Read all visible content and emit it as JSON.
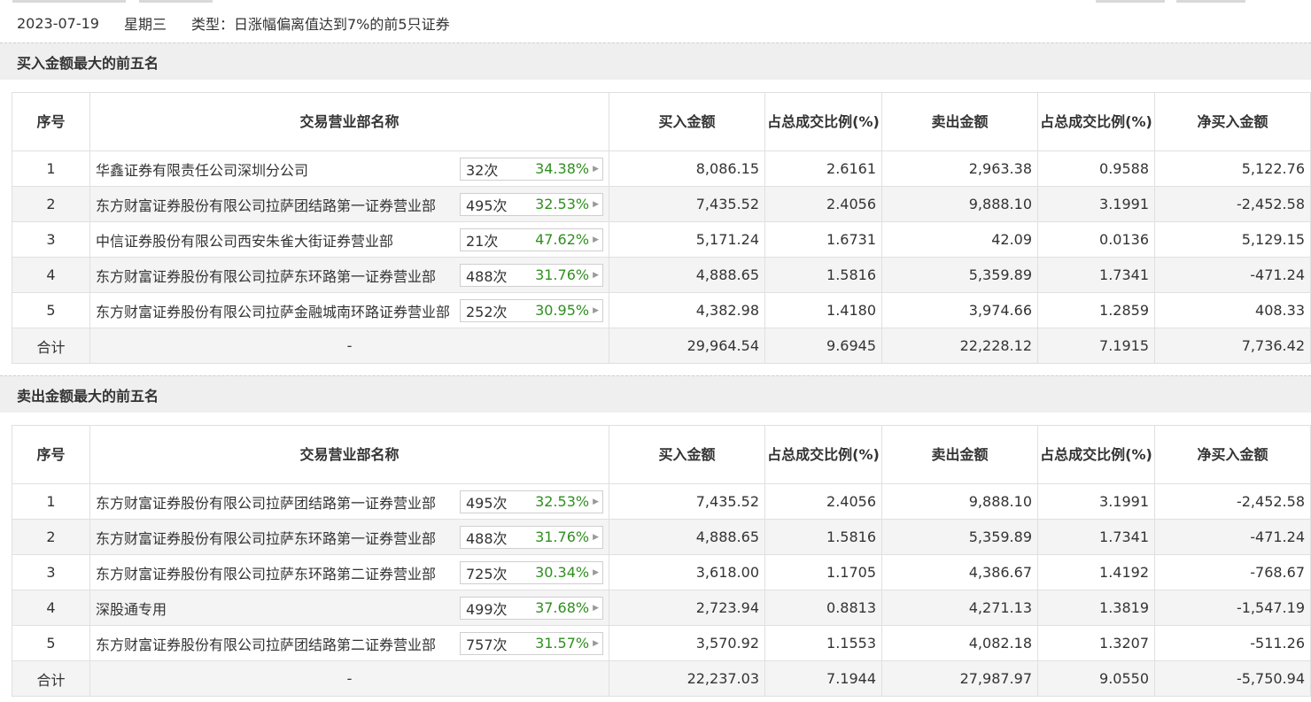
{
  "header": {
    "date": "2023-07-19",
    "weekday": "星期三",
    "type_text": "类型：日涨幅偏离值达到7%的前5只证券"
  },
  "columns": {
    "idx": "序号",
    "name": "交易营业部名称",
    "buy": "买入金额",
    "buy_ratio": "占总成交比例(%)",
    "sell": "卖出金额",
    "sell_ratio": "占总成交比例(%)",
    "net": "净买入金额"
  },
  "colors": {
    "up": "#e60000",
    "down": "#2f8f1f"
  },
  "icons": {
    "stat_arrow": "triangle-right-icon"
  },
  "buy_section": {
    "title": "买入金额最大的前五名",
    "rows": [
      {
        "idx": "1",
        "name": "华鑫证券有限责任公司深圳分公司",
        "count": "32次",
        "pct": "34.38%",
        "buy": "8,086.15",
        "buy_ratio": "2.6161",
        "sell": "2,963.38",
        "sell_ratio": "0.9588",
        "net": "5,122.76",
        "net_sign": "up"
      },
      {
        "idx": "2",
        "name": "东方财富证券股份有限公司拉萨团结路第一证券营业部",
        "count": "495次",
        "pct": "32.53%",
        "buy": "7,435.52",
        "buy_ratio": "2.4056",
        "sell": "9,888.10",
        "sell_ratio": "3.1991",
        "net": "-2,452.58",
        "net_sign": "down"
      },
      {
        "idx": "3",
        "name": "中信证券股份有限公司西安朱雀大街证券营业部",
        "count": "21次",
        "pct": "47.62%",
        "buy": "5,171.24",
        "buy_ratio": "1.6731",
        "sell": "42.09",
        "sell_ratio": "0.0136",
        "net": "5,129.15",
        "net_sign": "up"
      },
      {
        "idx": "4",
        "name": "东方财富证券股份有限公司拉萨东环路第一证券营业部",
        "count": "488次",
        "pct": "31.76%",
        "buy": "4,888.65",
        "buy_ratio": "1.5816",
        "sell": "5,359.89",
        "sell_ratio": "1.7341",
        "net": "-471.24",
        "net_sign": "down"
      },
      {
        "idx": "5",
        "name": "东方财富证券股份有限公司拉萨金融城南环路证券营业部",
        "count": "252次",
        "pct": "30.95%",
        "buy": "4,382.98",
        "buy_ratio": "1.4180",
        "sell": "3,974.66",
        "sell_ratio": "1.2859",
        "net": "408.33",
        "net_sign": "up"
      }
    ],
    "total": {
      "label": "合计",
      "name": "-",
      "buy": "29,964.54",
      "buy_ratio": "9.6945",
      "sell": "22,228.12",
      "sell_ratio": "7.1915",
      "net": "7,736.42",
      "net_sign": "up"
    }
  },
  "sell_section": {
    "title": "卖出金额最大的前五名",
    "rows": [
      {
        "idx": "1",
        "name": "东方财富证券股份有限公司拉萨团结路第一证券营业部",
        "count": "495次",
        "pct": "32.53%",
        "buy": "7,435.52",
        "buy_ratio": "2.4056",
        "sell": "9,888.10",
        "sell_ratio": "3.1991",
        "net": "-2,452.58",
        "net_sign": "down"
      },
      {
        "idx": "2",
        "name": "东方财富证券股份有限公司拉萨东环路第一证券营业部",
        "count": "488次",
        "pct": "31.76%",
        "buy": "4,888.65",
        "buy_ratio": "1.5816",
        "sell": "5,359.89",
        "sell_ratio": "1.7341",
        "net": "-471.24",
        "net_sign": "down"
      },
      {
        "idx": "3",
        "name": "东方财富证券股份有限公司拉萨东环路第二证券营业部",
        "count": "725次",
        "pct": "30.34%",
        "buy": "3,618.00",
        "buy_ratio": "1.1705",
        "sell": "4,386.67",
        "sell_ratio": "1.4192",
        "net": "-768.67",
        "net_sign": "down"
      },
      {
        "idx": "4",
        "name": "深股通专用",
        "count": "499次",
        "pct": "37.68%",
        "buy": "2,723.94",
        "buy_ratio": "0.8813",
        "sell": "4,271.13",
        "sell_ratio": "1.3819",
        "net": "-1,547.19",
        "net_sign": "down"
      },
      {
        "idx": "5",
        "name": "东方财富证券股份有限公司拉萨团结路第二证券营业部",
        "count": "757次",
        "pct": "31.57%",
        "buy": "3,570.92",
        "buy_ratio": "1.1553",
        "sell": "4,082.18",
        "sell_ratio": "1.3207",
        "net": "-511.26",
        "net_sign": "down"
      }
    ],
    "total": {
      "label": "合计",
      "name": "-",
      "buy": "22,237.03",
      "buy_ratio": "7.1944",
      "sell": "27,987.97",
      "sell_ratio": "9.0550",
      "net": "-5,750.94",
      "net_sign": "down"
    }
  }
}
